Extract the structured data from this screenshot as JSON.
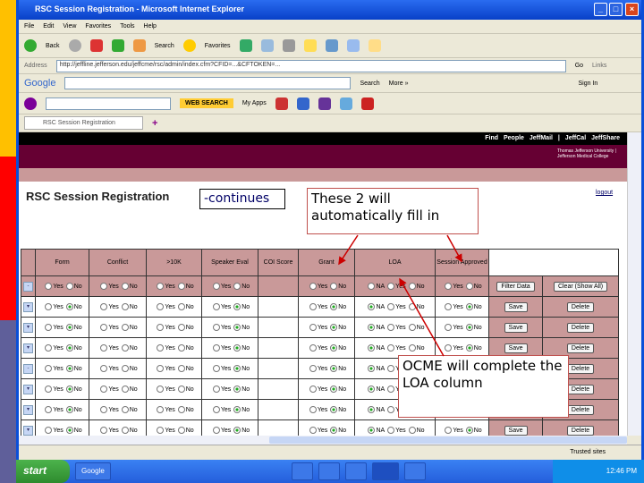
{
  "window": {
    "title": "RSC Session Registration - Microsoft Internet Explorer"
  },
  "menu": [
    "File",
    "Edit",
    "View",
    "Favorites",
    "Tools",
    "Help"
  ],
  "toolbar": {
    "back": "Back",
    "search": "Search",
    "favorites": "Favorites"
  },
  "address": {
    "label": "Address",
    "url": "http://jeffline.jefferson.edu/jeffcme/rsc/admin/index.cfm?CFID=...&CFTOKEN=...",
    "go": "Go",
    "links": "Links"
  },
  "google": {
    "logo": "Google",
    "search": "Search",
    "more": "More »",
    "signin": "Sign In"
  },
  "yahoo": {
    "web_search": "WEB SEARCH",
    "my_apps": "My Apps"
  },
  "tab": {
    "label": "RSC Session Registration"
  },
  "site": {
    "links": "Find People  JeffMail | JeffCal  JeffShare",
    "logo": "Thomas Jefferson University | Jefferson Medical College",
    "page_title": "RSC Session Registration",
    "logout": "logout"
  },
  "callouts": {
    "continues": "-continues",
    "auto": "These 2 will automatically fill in",
    "ocme": "OCME will complete the LOA column"
  },
  "table": {
    "headers": [
      "Form",
      "Conflict",
      ">10K",
      "Speaker Eval",
      "COI Score",
      "Grant",
      "LOA",
      "Session Approved"
    ],
    "filter_button": "Filter Data",
    "clear_button": "Clear (Show All)",
    "save": "Save",
    "delete": "Delete",
    "rows": [
      {
        "form": "No",
        "conflict": "",
        "k10": "",
        "speaker": "No",
        "grant": "No",
        "loa": "NA",
        "session": "No"
      },
      {
        "form": "No",
        "conflict": "",
        "k10": "",
        "speaker": "No",
        "grant": "No",
        "loa": "NA",
        "session": "No"
      },
      {
        "form": "No",
        "conflict": "",
        "k10": "",
        "speaker": "No",
        "grant": "No",
        "loa": "NA",
        "session": "No"
      },
      {
        "form": "No",
        "conflict": "",
        "k10": "",
        "speaker": "No",
        "grant": "No",
        "loa": "NA",
        "session": "No"
      },
      {
        "form": "No",
        "conflict": "",
        "k10": "",
        "speaker": "No",
        "grant": "No",
        "loa": "NA",
        "session": "No"
      },
      {
        "form": "No",
        "conflict": "",
        "k10": "",
        "speaker": "No",
        "grant": "No",
        "loa": "NA",
        "session": "No"
      },
      {
        "form": "No",
        "conflict": "",
        "k10": "",
        "speaker": "No",
        "grant": "No",
        "loa": "NA",
        "session": "No"
      }
    ]
  },
  "status": {
    "zone": "Trusted sites"
  },
  "taskbar": {
    "start": "start",
    "google": "Google",
    "clock": "12:46 PM"
  }
}
